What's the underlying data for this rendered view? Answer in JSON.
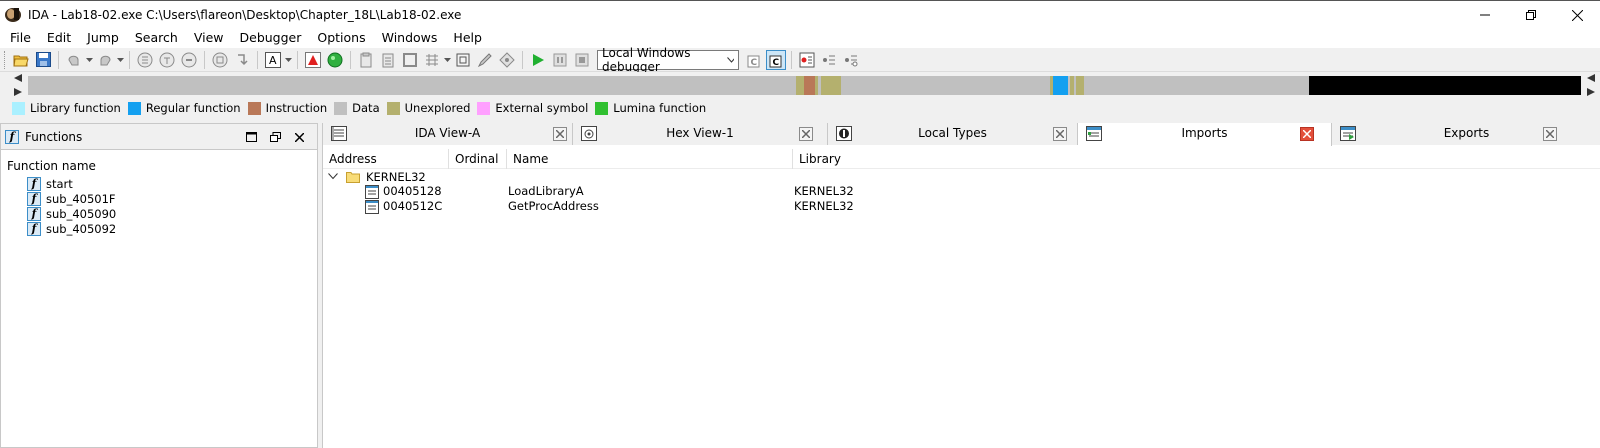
{
  "window": {
    "title": "IDA - Lab18-02.exe C:\\Users\\flareon\\Desktop\\Chapter_18L\\Lab18-02.exe"
  },
  "menu": [
    "File",
    "Edit",
    "Jump",
    "Search",
    "View",
    "Debugger",
    "Options",
    "Windows",
    "Help"
  ],
  "toolbar": {
    "debugger_select": "Local Windows debugger"
  },
  "legend": [
    {
      "label": "Library function",
      "color": "#aaf0ff"
    },
    {
      "label": "Regular function",
      "color": "#14a0f0"
    },
    {
      "label": "Instruction",
      "color": "#b97858"
    },
    {
      "label": "Data",
      "color": "#c0c0c0"
    },
    {
      "label": "Unexplored",
      "color": "#b4b06e"
    },
    {
      "label": "External symbol",
      "color": "#ffa0ff"
    },
    {
      "label": "Lumina function",
      "color": "#30c030"
    }
  ],
  "functions_panel": {
    "title": "Functions",
    "column": "Function name",
    "items": [
      "start",
      "sub_40501F",
      "sub_405090",
      "sub_405092"
    ]
  },
  "tabs": [
    {
      "label": "IDA View-A"
    },
    {
      "label": "Hex View-1"
    },
    {
      "label": "Local Types"
    },
    {
      "label": "Imports"
    },
    {
      "label": "Exports"
    }
  ],
  "imports": {
    "columns": [
      "Address",
      "Ordinal",
      "Name",
      "Library"
    ],
    "group": "KERNEL32",
    "rows": [
      {
        "address": "00405128",
        "ordinal": "",
        "name": "LoadLibraryA",
        "library": "KERNEL32"
      },
      {
        "address": "0040512C",
        "ordinal": "",
        "name": "GetProcAddress",
        "library": "KERNEL32"
      }
    ]
  }
}
